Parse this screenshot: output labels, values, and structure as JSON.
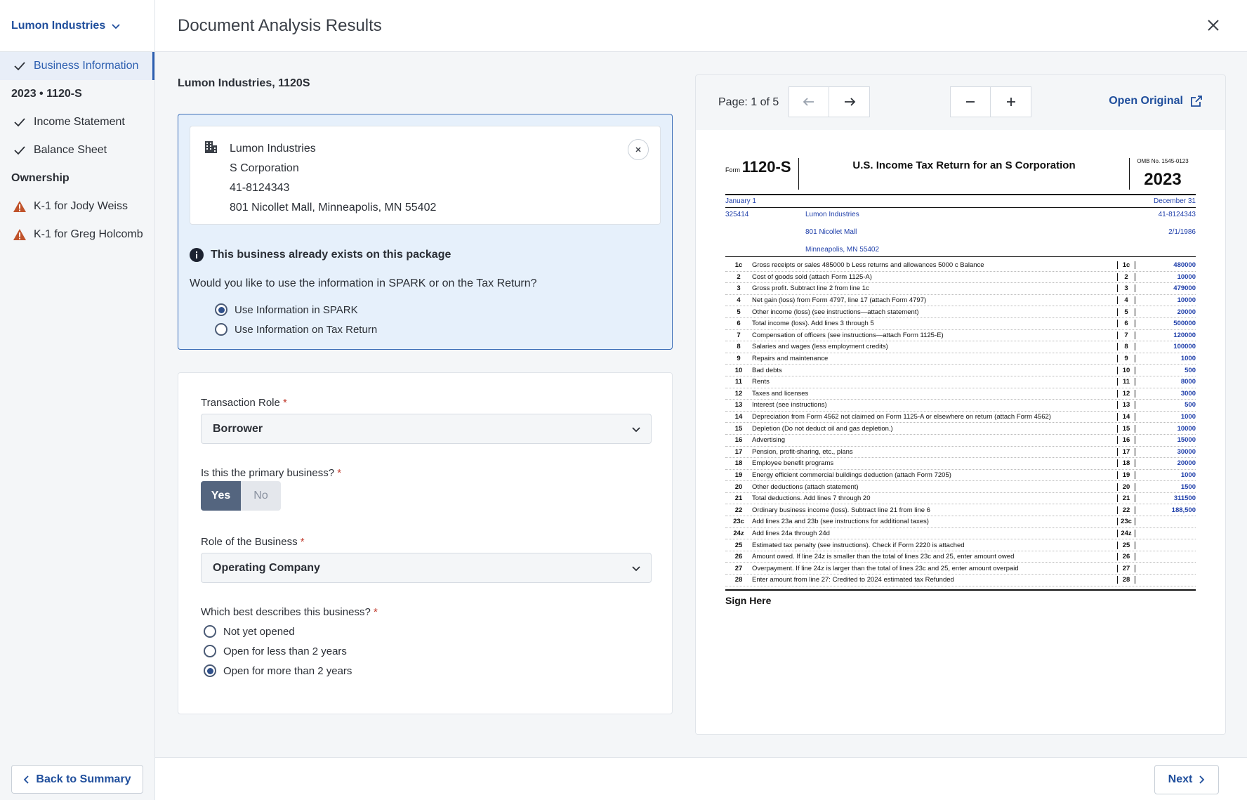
{
  "sidebar": {
    "company": "Lumon Industries",
    "items": [
      {
        "label": "Business Information",
        "status": "done",
        "active": true
      },
      {
        "group": "2023 • 1120-S"
      },
      {
        "label": "Income Statement",
        "status": "done"
      },
      {
        "label": "Balance Sheet",
        "status": "done"
      },
      {
        "group": "Ownership"
      },
      {
        "label": "K-1 for Jody Weiss",
        "status": "warning"
      },
      {
        "label": "K-1 for Greg Holcomb",
        "status": "warning"
      }
    ],
    "back_label": "Back to Summary"
  },
  "header": {
    "title": "Document Analysis Results"
  },
  "main": {
    "business_heading": "Lumon Industries, 1120S",
    "business_card": {
      "name": "Lumon Industries",
      "type": "S Corporation",
      "ein": "41-8124343",
      "address": "801 Nicollet Mall, Minneapolis, MN 55402"
    },
    "alert_title": "This business already exists on this package",
    "alert_question": "Would you like to use the information in SPARK or on the Tax Return?",
    "alert_options": [
      {
        "label": "Use Information in SPARK",
        "selected": true
      },
      {
        "label": "Use Information on Tax Return",
        "selected": false
      }
    ],
    "form": {
      "transaction_role_label": "Transaction Role",
      "transaction_role_value": "Borrower",
      "primary_label": "Is this the primary business?",
      "primary_yes": "Yes",
      "primary_no": "No",
      "business_role_label": "Role of the Business",
      "business_role_value": "Operating Company",
      "describe_label": "Which best describes this business?",
      "describe_options": [
        {
          "label": "Not yet opened",
          "selected": false
        },
        {
          "label": "Open for less than 2 years",
          "selected": false
        },
        {
          "label": "Open for more than 2 years",
          "selected": true
        }
      ]
    }
  },
  "viewer": {
    "page_label": "Page: 1 of 5",
    "open_original": "Open Original",
    "doc": {
      "form_no": "1120-S",
      "title": "U.S. Income Tax Return for an S Corporation",
      "omb": "OMB No. 1545-0123",
      "year": "2023",
      "entity_name": "Lumon Industries",
      "street": "801 Nicollet Mall",
      "city": "Minneapolis, MN 55402",
      "ein": "41-8124343",
      "date_inc": "2/1/1986",
      "activity_code": "325414",
      "tax_year_begin": "January 1",
      "tax_year_end": "December 31",
      "lines": [
        {
          "n": "1c",
          "label": "Gross receipts or sales  485000   b Less returns and allowances  5000   c Balance",
          "value": "480000"
        },
        {
          "n": "2",
          "label": "Cost of goods sold (attach Form 1125-A)",
          "value": "10000"
        },
        {
          "n": "3",
          "label": "Gross profit. Subtract line 2 from line 1c",
          "value": "479000"
        },
        {
          "n": "4",
          "label": "Net gain (loss) from Form 4797, line 17 (attach Form 4797)",
          "value": "10000"
        },
        {
          "n": "5",
          "label": "Other income (loss) (see instructions—attach statement)",
          "value": "20000"
        },
        {
          "n": "6",
          "label": "Total income (loss). Add lines 3 through 5",
          "value": "500000"
        },
        {
          "n": "7",
          "label": "Compensation of officers (see instructions—attach Form 1125-E)",
          "value": "120000"
        },
        {
          "n": "8",
          "label": "Salaries and wages (less employment credits)",
          "value": "100000"
        },
        {
          "n": "9",
          "label": "Repairs and maintenance",
          "value": "1000"
        },
        {
          "n": "10",
          "label": "Bad debts",
          "value": "500"
        },
        {
          "n": "11",
          "label": "Rents",
          "value": "8000"
        },
        {
          "n": "12",
          "label": "Taxes and licenses",
          "value": "3000"
        },
        {
          "n": "13",
          "label": "Interest (see instructions)",
          "value": "500"
        },
        {
          "n": "14",
          "label": "Depreciation from Form 4562 not claimed on Form 1125-A or elsewhere on return (attach Form 4562)",
          "value": "1000"
        },
        {
          "n": "15",
          "label": "Depletion (Do not deduct oil and gas depletion.)",
          "value": "10000"
        },
        {
          "n": "16",
          "label": "Advertising",
          "value": "15000"
        },
        {
          "n": "17",
          "label": "Pension, profit-sharing, etc., plans",
          "value": "30000"
        },
        {
          "n": "18",
          "label": "Employee benefit programs",
          "value": "20000"
        },
        {
          "n": "19",
          "label": "Energy efficient commercial buildings deduction (attach Form 7205)",
          "value": "1000"
        },
        {
          "n": "20",
          "label": "Other deductions (attach statement)",
          "value": "1500"
        },
        {
          "n": "21",
          "label": "Total deductions. Add lines 7 through 20",
          "value": "311500"
        },
        {
          "n": "22",
          "label": "Ordinary business income (loss). Subtract line 21 from line 6",
          "value": "188,500"
        },
        {
          "n": "23c",
          "label": "Add lines 23a and 23b (see instructions for additional taxes)",
          "value": ""
        },
        {
          "n": "24z",
          "label": "Add lines 24a through 24d",
          "value": ""
        },
        {
          "n": "25",
          "label": "Estimated tax penalty (see instructions). Check if Form 2220 is attached",
          "value": ""
        },
        {
          "n": "26",
          "label": "Amount owed. If line 24z is smaller than the total of lines 23c and 25, enter amount owed",
          "value": ""
        },
        {
          "n": "27",
          "label": "Overpayment. If line 24z is larger than the total of lines 23c and 25, enter amount overpaid",
          "value": ""
        },
        {
          "n": "28",
          "label": "Enter amount from line 27:  Credited to 2024 estimated tax   Refunded",
          "value": ""
        }
      ],
      "sign_here": "Sign Here"
    }
  },
  "footer": {
    "next_label": "Next"
  },
  "colors": {
    "accent": "#1f4e9c",
    "warning": "#c0532b",
    "alert_bg": "#e6f0fb"
  }
}
